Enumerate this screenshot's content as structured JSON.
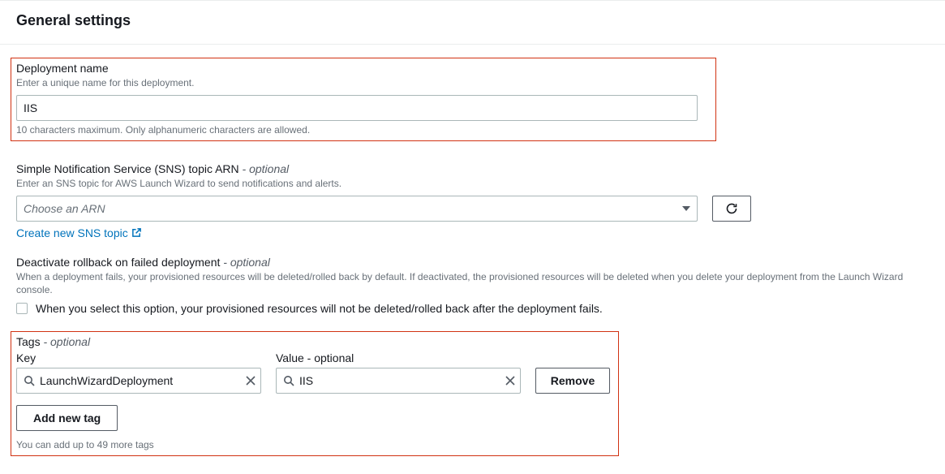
{
  "header": {
    "title": "General settings"
  },
  "deployment": {
    "label": "Deployment name",
    "desc": "Enter a unique name for this deployment.",
    "value": "IIS",
    "hint": "10 characters maximum. Only alphanumeric characters are allowed."
  },
  "sns": {
    "label_main": "Simple Notification Service (SNS) topic ARN",
    "label_optional": " - optional",
    "desc": "Enter an SNS topic for AWS Launch Wizard to send notifications and alerts.",
    "placeholder": "Choose an ARN",
    "link": "Create new SNS topic"
  },
  "rollback": {
    "label_main": "Deactivate rollback on failed deployment",
    "label_optional": " - optional",
    "desc": "When a deployment fails, your provisioned resources will be deleted/rolled back by default. If deactivated, the provisioned resources will be deleted when you delete your deployment from the Launch Wizard console.",
    "checkbox_label": "When you select this option, your provisioned resources will not be deleted/rolled back after the deployment fails."
  },
  "tags": {
    "label_main": "Tags",
    "label_optional": " - optional",
    "key_header": "Key",
    "value_header_main": "Value",
    "value_header_optional": " - optional",
    "rows": [
      {
        "key": "LaunchWizardDeployment",
        "value": "IIS"
      }
    ],
    "remove_label": "Remove",
    "add_label": "Add new tag",
    "hint": "You can add up to 49 more tags"
  }
}
